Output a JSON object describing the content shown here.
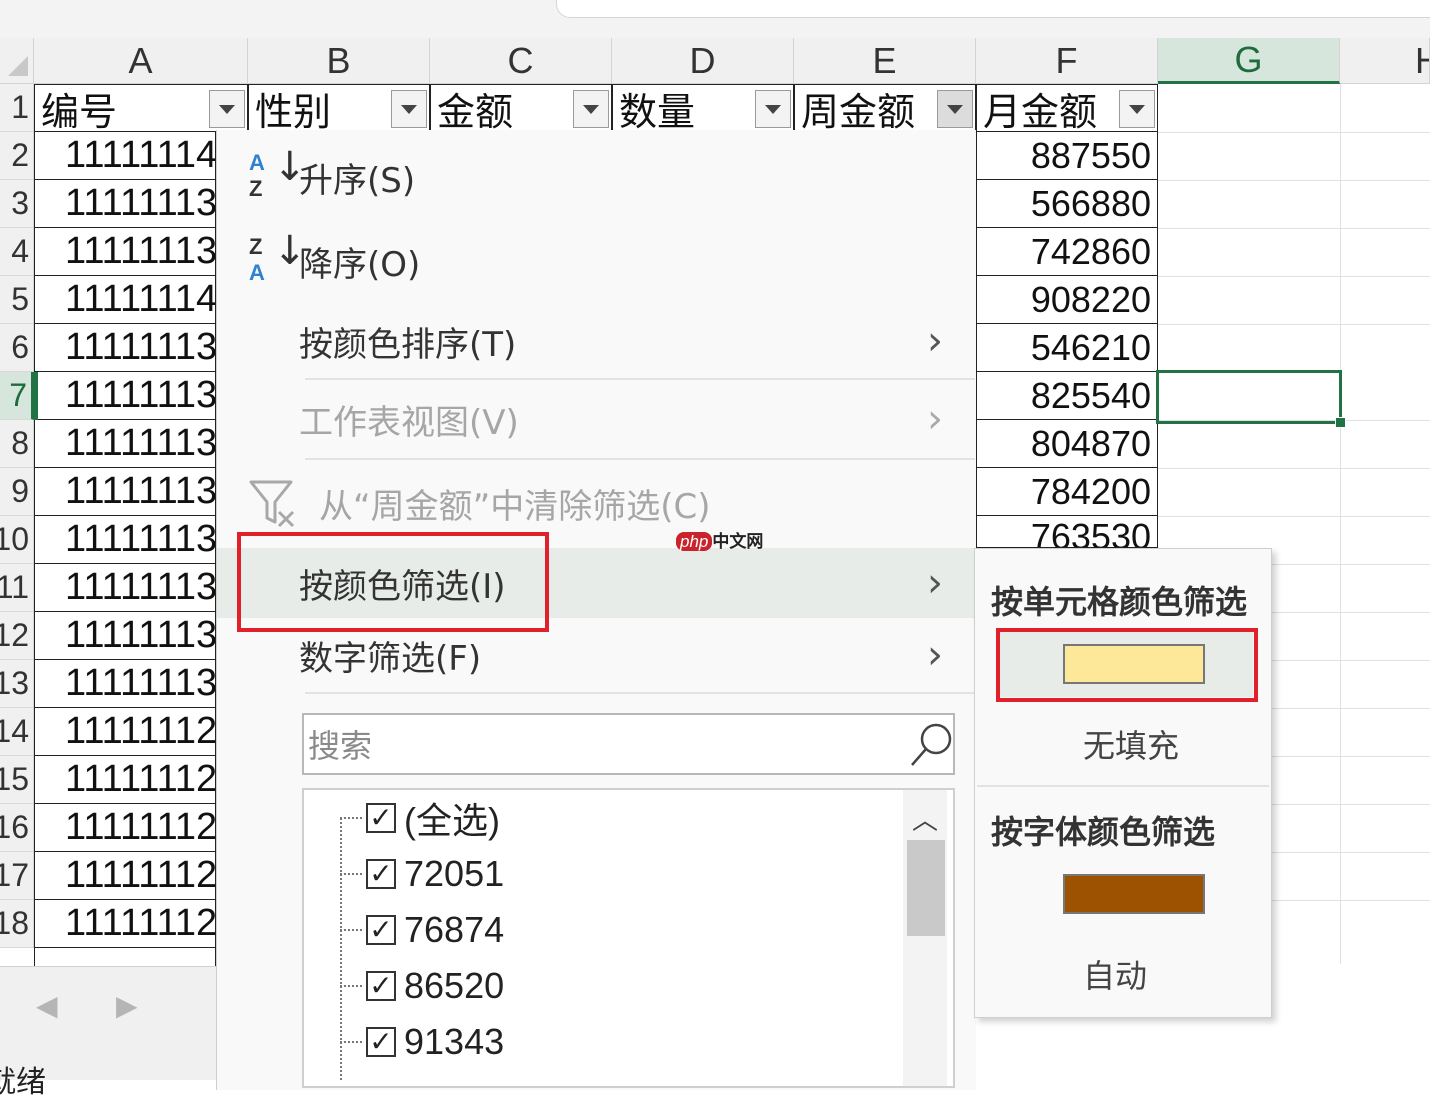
{
  "columns": [
    "A",
    "B",
    "C",
    "D",
    "E",
    "F",
    "G",
    "H"
  ],
  "rows": [
    "1",
    "2",
    "3",
    "4",
    "5",
    "6",
    "7",
    "8",
    "9",
    "10",
    "11",
    "12",
    "13",
    "14",
    "15",
    "16",
    "17",
    "18"
  ],
  "headers": {
    "a": "编号",
    "b": "性别",
    "c": "金额",
    "d": "数量",
    "e": "周金额",
    "f": "月金额"
  },
  "col_a_values": [
    "11111114",
    "11111113",
    "11111113",
    "11111114",
    "11111113",
    "11111113",
    "11111113",
    "11111113",
    "11111113",
    "11111113",
    "11111113",
    "11111113",
    "11111112",
    "11111112",
    "11111112",
    "11111112",
    "11111112"
  ],
  "col_f_values": [
    "887550",
    "566880",
    "742860",
    "908220",
    "546210",
    "825540",
    "804870",
    "784200",
    "763530"
  ],
  "menu": {
    "sort_asc": "升序(S)",
    "sort_desc": "降序(O)",
    "sort_by_color": "按颜色排序(T)",
    "sheet_view": "工作表视图(V)",
    "clear_filter": "从“周金额”中清除筛选(C)",
    "filter_by_color": "按颜色筛选(I)",
    "number_filter": "数字筛选(F)",
    "chevron": "›",
    "search_placeholder": "搜索",
    "list": [
      "(全选)",
      "72051",
      "76874",
      "86520",
      "91343"
    ]
  },
  "submenu": {
    "cell_color_title": "按单元格颜色筛选",
    "no_fill": "无填充",
    "font_color_title": "按字体颜色筛选",
    "auto": "自动"
  },
  "colors": {
    "cell_swatch": "#fde89a",
    "font_swatch": "#9c5200",
    "highlight_red": "#e0202a",
    "excel_green": "#217346"
  },
  "watermark": "php中文网",
  "status": "就绪"
}
